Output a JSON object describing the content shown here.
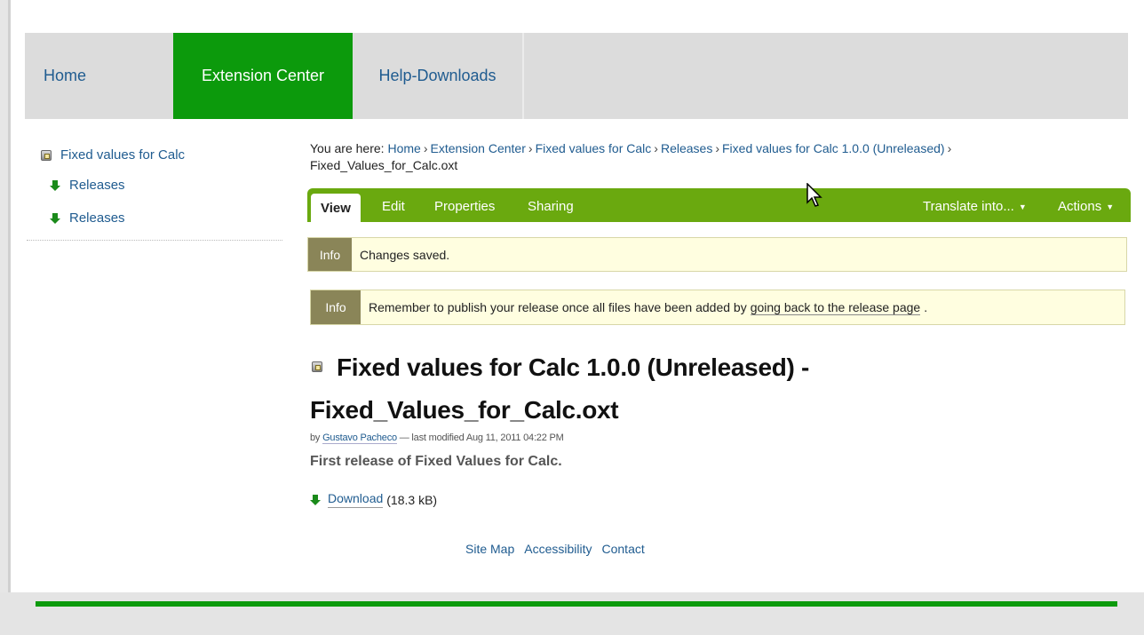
{
  "nav": {
    "tabs": [
      {
        "label": "Home"
      },
      {
        "label": "Extension Center"
      },
      {
        "label": "Help-Downloads"
      }
    ]
  },
  "sidebar": {
    "title": "Fixed values for Calc",
    "items": [
      {
        "label": "Releases"
      },
      {
        "label": "Releases"
      }
    ]
  },
  "breadcrumb": {
    "prefix": "You are here:",
    "items": [
      "Home",
      "Extension Center",
      "Fixed values for Calc",
      "Releases",
      "Fixed values for Calc 1.0.0 (Unreleased)",
      "Fixed_Values_for_Calc.oxt"
    ]
  },
  "actions": {
    "view": "View",
    "edit": "Edit",
    "properties": "Properties",
    "sharing": "Sharing",
    "translate": "Translate into...",
    "actions": "Actions"
  },
  "messages": [
    {
      "tag": "Info",
      "text": "Changes saved."
    },
    {
      "tag": "Info",
      "text": "Remember to publish your release once all files have been added by",
      "link": "going back to the release page",
      "suffix": "."
    }
  ],
  "document": {
    "title_line1": "Fixed values for Calc 1.0.0 (Unreleased) -",
    "title_line2": "Fixed_Values_for_Calc.oxt",
    "by": "by",
    "author": "Gustavo Pacheco",
    "modified": "— last modified Aug 11, 2011 04:22 PM",
    "description": "First release of Fixed Values for Calc.",
    "download_label": "Download",
    "download_size": "(18.3 kB)"
  },
  "footer": {
    "links": [
      "Site Map",
      "Accessibility",
      "Contact"
    ]
  },
  "colors": {
    "brand_green": "#0c9a0c",
    "action_bar": "#6aa90f",
    "link": "#205c90",
    "info_bg": "#fffee0"
  }
}
